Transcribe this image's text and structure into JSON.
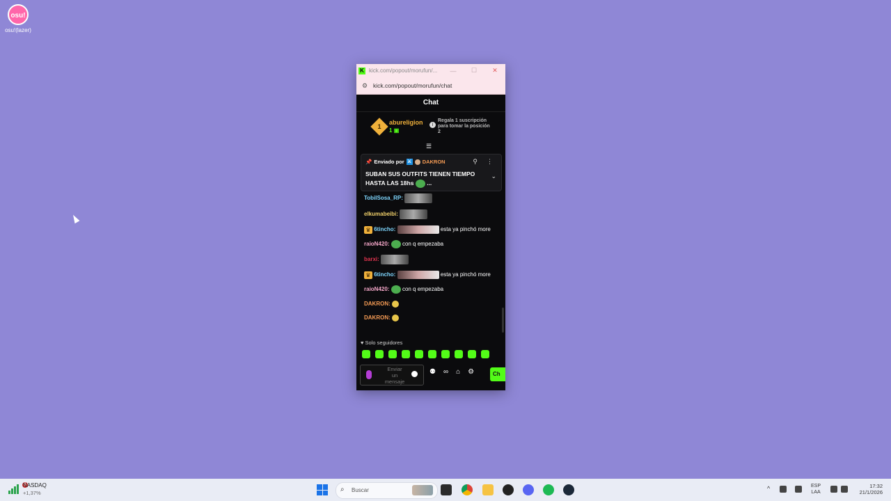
{
  "desktop": {
    "icon_text": "osu!",
    "icon_label": "osu!(lazer)"
  },
  "window": {
    "title": "kick.com/popout/morufun/...",
    "url": "kick.com/popout/morufun/chat",
    "buttons": {
      "minimize": "—",
      "maximize": "☐",
      "close": "✕"
    }
  },
  "chat": {
    "header": "Chat",
    "leaderboard": {
      "rank": "1",
      "name": "abureligion",
      "count": "1",
      "gift_text": "Regala 1 suscripción para tomar la posición 2"
    },
    "pinned": {
      "sent_by": "Enviado por",
      "user": "DAKRON",
      "message": "SUBAN SUS OUTFITS TIENEN TIEMPO HASTA LAS 18hs",
      "more": "..."
    },
    "messages": [
      {
        "user": "TobilSosa_RP:",
        "color": "#7fd7ff",
        "text": "",
        "emote": "img",
        "crown": false
      },
      {
        "user": "elkumabeibi:",
        "color": "#f0d06a",
        "text": "",
        "emote": "img",
        "crown": false
      },
      {
        "user": "6tincho:",
        "color": "#7fd7ff",
        "text": "esta ya pinchó more",
        "emote": "wide",
        "crown": true
      },
      {
        "user": "raioN420:",
        "color": "#f5a7c9",
        "text": "con q empezaba",
        "emote": "frog",
        "crown": false
      },
      {
        "user": "barxi:",
        "color": "#e3344f",
        "text": "",
        "emote": "img",
        "crown": false
      },
      {
        "user": "6tincho:",
        "color": "#7fd7ff",
        "text": "esta ya pinchó more",
        "emote": "wide",
        "crown": true
      },
      {
        "user": "raioN420:",
        "color": "#f5a7c9",
        "text": "con q empezaba",
        "emote": "frog",
        "crown": false
      },
      {
        "user": "DAKRON:",
        "color": "#f59b54",
        "text": "",
        "emote": "face",
        "crown": false
      },
      {
        "user": "DAKRON:",
        "color": "#f59b54",
        "text": "",
        "emote": "face",
        "crown": false
      }
    ],
    "followers_only": "Solo seguidores",
    "composer": {
      "placeholder": "Enviar un mensaje",
      "send": "Ch"
    }
  },
  "taskbar": {
    "stock_name": "NASDAQ",
    "stock_change": "+1,37%",
    "stock_notif": "6",
    "search_placeholder": "Buscar",
    "lang_top": "ESP",
    "lang_bottom": "LAA",
    "time": "17:32",
    "date": "21/1/2026"
  },
  "colors": {
    "desktop_bg": "#8f87d6",
    "kick_green": "#53fc18",
    "chat_bg": "#0b0b0d"
  }
}
